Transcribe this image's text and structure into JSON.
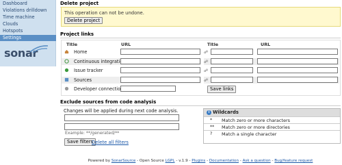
{
  "sidebar": {
    "items": [
      "Dashboard",
      "Violations drilldown",
      "Time machine",
      "Clouds",
      "Hotspots",
      "Settings"
    ],
    "active": "Settings",
    "logo": "sonar"
  },
  "delete_project": {
    "title": "Delete project",
    "warning": "This operation can not be undone.",
    "button": "Delete project"
  },
  "project_links": {
    "title": "Project links",
    "col_title": "Title",
    "col_url": "URL",
    "rows": [
      {
        "label": "Home",
        "icon": "home-icon"
      },
      {
        "label": "Continuous integration",
        "icon": "ci-icon"
      },
      {
        "label": "Issue tracker",
        "icon": "bug-icon"
      },
      {
        "label": "Sources",
        "icon": "sources-icon"
      },
      {
        "label": "Developer connection",
        "icon": "developer-icon"
      }
    ],
    "save_button": "Save links"
  },
  "exclusions": {
    "title": "Exclude sources from code analysis",
    "note": "Changes will be applied during next code analysis.",
    "example": "Example: **/generated/**",
    "save_button": "Save filters",
    "delete_all": "Delete all filters"
  },
  "wildcards": {
    "title": "Wildcards",
    "rows": [
      {
        "symbol": "*",
        "desc": "Match zero or more characters"
      },
      {
        "symbol": "**",
        "desc": "Match zero or more directories"
      },
      {
        "symbol": "?",
        "desc": "Match a single character"
      }
    ]
  },
  "footer": {
    "powered_by": "Powered by",
    "sonarsource": "SonarSource",
    "opensource": " - Open Source ",
    "lgpl": "LGPL",
    "version": " - v.1.9 - ",
    "plugins": "Plugins",
    "documentation": "Documentation",
    "ask": "Ask a question",
    "bug": "Bug/feature request",
    "sep": " - "
  }
}
